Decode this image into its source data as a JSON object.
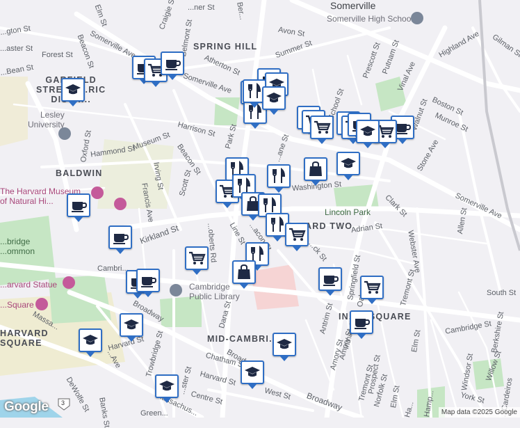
{
  "map": {
    "city": "Somerville",
    "areas": [
      {
        "id": "spring-hill",
        "text": "SPRING HILL"
      },
      {
        "id": "garfield",
        "text": "GARFIELD\nSTREET ...RIC\nDISTR..."
      },
      {
        "id": "baldwin",
        "text": "BALDWIN"
      },
      {
        "id": "ward-two",
        "text": "...ARD TWO"
      },
      {
        "id": "inman-square",
        "text": "IN...N SQUARE"
      },
      {
        "id": "mid-cambridge",
        "text": "MID-CAMBRI..."
      },
      {
        "id": "harvard-square",
        "text": "HARVARD\nSQUARE"
      },
      {
        "id": "cambridge-common",
        "text": "...bridge\n...ommon"
      }
    ],
    "pois": [
      {
        "id": "somerville-high-school",
        "text": "Somerville High School"
      },
      {
        "id": "lesley-university",
        "text": "Lesley\nUniversity"
      },
      {
        "id": "harvard-museum",
        "text": "The Harvard Museum\nof Natural Hi..."
      },
      {
        "id": "cambridge-public-library",
        "text": "Cambridge\nPublic Library"
      },
      {
        "id": "lincoln-park",
        "text": "Lincoln Park"
      },
      {
        "id": "harvard-statue",
        "text": "...arvard Statue"
      },
      {
        "id": "square-poi",
        "text": "...Square"
      }
    ],
    "streets": [
      {
        "id": "s1",
        "text": "Elm St"
      },
      {
        "id": "s2",
        "text": "Craigie St"
      },
      {
        "id": "s3",
        "text": "...ner St"
      },
      {
        "id": "s4",
        "text": "...gton St"
      },
      {
        "id": "s5",
        "text": "Beacon St"
      },
      {
        "id": "s6",
        "text": "Somerville Ave"
      },
      {
        "id": "s7",
        "text": "...aster St"
      },
      {
        "id": "s8",
        "text": "Forest St"
      },
      {
        "id": "s9",
        "text": "...Bean St"
      },
      {
        "id": "s10",
        "text": "Belmont St"
      },
      {
        "id": "s11",
        "text": "Ber..."
      },
      {
        "id": "s12",
        "text": "Avon St"
      },
      {
        "id": "s13",
        "text": "Summer St"
      },
      {
        "id": "s14",
        "text": "Atherton St"
      },
      {
        "id": "s15",
        "text": "Somerville Ave"
      },
      {
        "id": "s16",
        "text": "Prescott St"
      },
      {
        "id": "s17",
        "text": "Putnam St"
      },
      {
        "id": "s18",
        "text": "Vinal Ave"
      },
      {
        "id": "s19",
        "text": "Highland Ave"
      },
      {
        "id": "s20",
        "text": "Gilman St"
      },
      {
        "id": "s21",
        "text": "Harrison St"
      },
      {
        "id": "s22",
        "text": "Park St"
      },
      {
        "id": "s23",
        "text": "School St"
      },
      {
        "id": "s24",
        "text": "Walnut St"
      },
      {
        "id": "s25",
        "text": "Boston St"
      },
      {
        "id": "s26",
        "text": "Munroe St"
      },
      {
        "id": "s27",
        "text": "Hammond St"
      },
      {
        "id": "s28",
        "text": "Museum St"
      },
      {
        "id": "s29",
        "text": "Oxford St"
      },
      {
        "id": "s30",
        "text": "Beacon St"
      },
      {
        "id": "s31",
        "text": "...ane St"
      },
      {
        "id": "s32",
        "text": "Stone Ave"
      },
      {
        "id": "s33",
        "text": "Irving St"
      },
      {
        "id": "s34",
        "text": "Scott St"
      },
      {
        "id": "s35",
        "text": "Francis Ave"
      },
      {
        "id": "s36",
        "text": "Washington St"
      },
      {
        "id": "s37",
        "text": "Clark St"
      },
      {
        "id": "s38",
        "text": "Somerville Ave"
      },
      {
        "id": "s39",
        "text": "Allen St"
      },
      {
        "id": "s40",
        "text": "Kirkland St"
      },
      {
        "id": "s41",
        "text": "Line St"
      },
      {
        "id": "s42",
        "text": "...acon St"
      },
      {
        "id": "s43",
        "text": "Adrian St"
      },
      {
        "id": "s44",
        "text": "...ck St"
      },
      {
        "id": "s45",
        "text": "...oberts Rd"
      },
      {
        "id": "s46",
        "text": "Cambri..."
      },
      {
        "id": "s47",
        "text": "Springfield St"
      },
      {
        "id": "s48",
        "text": "Oak St"
      },
      {
        "id": "s49",
        "text": "Tremont St"
      },
      {
        "id": "s50",
        "text": "Webster Ave"
      },
      {
        "id": "s51",
        "text": "South St"
      },
      {
        "id": "s52",
        "text": "Broadway"
      },
      {
        "id": "s53",
        "text": "Antrim St"
      },
      {
        "id": "s54",
        "text": "Inman St"
      },
      {
        "id": "s55",
        "text": "Amory St"
      },
      {
        "id": "s56",
        "text": "Cambridge St"
      },
      {
        "id": "s57",
        "text": "Elm St"
      },
      {
        "id": "s58",
        "text": "Dana St"
      },
      {
        "id": "s59",
        "text": "Harvard St"
      },
      {
        "id": "s60",
        "text": "Massa..."
      },
      {
        "id": "s61",
        "text": "...Ave"
      },
      {
        "id": "s62",
        "text": "Trowbridge St"
      },
      {
        "id": "s63",
        "text": "Chatham St"
      },
      {
        "id": "s64",
        "text": "Harvard St"
      },
      {
        "id": "s65",
        "text": "Prospect St"
      },
      {
        "id": "s66",
        "text": "Tremont St"
      },
      {
        "id": "s67",
        "text": "Norfolk St"
      },
      {
        "id": "s68",
        "text": "Elm St"
      },
      {
        "id": "s69",
        "text": "Windsor St"
      },
      {
        "id": "s70",
        "text": "Willow St"
      },
      {
        "id": "s71",
        "text": "Berkshire St"
      },
      {
        "id": "s72",
        "text": "DeWolfe St"
      },
      {
        "id": "s73",
        "text": "Banks St"
      },
      {
        "id": "s74",
        "text": "...ster St"
      },
      {
        "id": "s75",
        "text": "Centre St"
      },
      {
        "id": "s76",
        "text": "West St"
      },
      {
        "id": "s77",
        "text": "Broadway"
      },
      {
        "id": "s78",
        "text": "Massachus..."
      },
      {
        "id": "s79",
        "text": "Green..."
      },
      {
        "id": "s80",
        "text": "York St"
      },
      {
        "id": "s81",
        "text": "Hamp..."
      },
      {
        "id": "s82",
        "text": "...Cardeiros"
      },
      {
        "id": "s83",
        "text": "Ha..."
      },
      {
        "id": "s84",
        "text": "Broadway"
      },
      {
        "id": "s85",
        "text": "Amory St"
      }
    ],
    "route_shield": "3",
    "markers": [
      "school-icon",
      "cafe-icon",
      "grocery-icon",
      "cafe-icon",
      "shop-icon",
      "restaurant-icon",
      "cafe-icon",
      "school-icon",
      "restaurant-icon",
      "school-icon",
      "cafe-icon",
      "grocery-icon",
      "grocery-icon",
      "cafe-icon",
      "grocery-icon",
      "cafe-icon",
      "cafe-icon",
      "grocery-icon",
      "school-icon",
      "school-icon",
      "shop-icon",
      "restaurant-icon",
      "restaurant-icon",
      "grocery-icon",
      "restaurant-icon",
      "shop-icon",
      "restaurant-icon",
      "restaurant-icon",
      "grocery-icon",
      "cafe-icon",
      "cafe-icon",
      "cafe-icon",
      "grocery-icon",
      "restaurant-icon",
      "shop-icon",
      "cafe-icon",
      "grocery-icon",
      "cafe-icon",
      "cafe-icon",
      "school-icon",
      "school-icon",
      "school-icon",
      "school-icon",
      "school-icon"
    ],
    "attribution": "Map data ©2025 Google",
    "logo": "Google",
    "colors": {
      "marker_border": "#2f6ec4",
      "marker_icon": "#1f2a44",
      "park": "#c6e6c4",
      "road": "#ffffff",
      "campus": "#ecebd8"
    }
  }
}
